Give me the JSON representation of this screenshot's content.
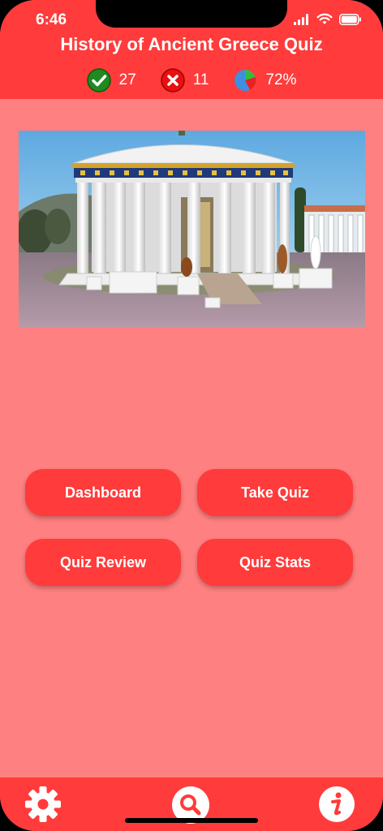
{
  "status_bar": {
    "time": "6:46",
    "icons": [
      "signal-icon",
      "wifi-icon",
      "battery-icon"
    ]
  },
  "header": {
    "title": "History of Ancient Greece Quiz",
    "stats": {
      "correct": "27",
      "incorrect": "11",
      "score": "72%"
    }
  },
  "hero_image": {
    "subject": "temple-image"
  },
  "menu": {
    "dashboard": "Dashboard",
    "take_quiz": "Take Quiz",
    "quiz_review": "Quiz Review",
    "quiz_stats": "Quiz Stats"
  },
  "footer": {
    "icons": [
      "gear-icon",
      "search-icon",
      "info-icon"
    ]
  },
  "colors": {
    "accent": "#ff3b3b",
    "background": "#ff8080",
    "correct": "#1f8a1f",
    "incorrect": "#e81010"
  }
}
